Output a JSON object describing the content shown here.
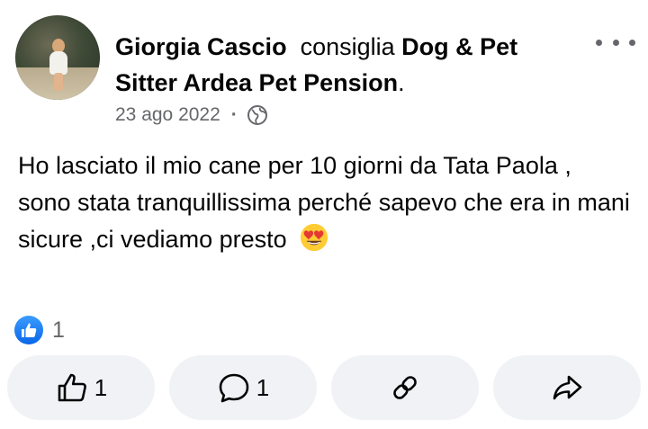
{
  "post": {
    "author": "Giorgia Cascio",
    "verb": "consiglia",
    "page_name": "Dog & Pet Sitter Ardea Pet Pension",
    "period": ".",
    "date": "23 ago 2022",
    "separator": "·",
    "audience_icon": "globe-icon",
    "text": "Ho lasciato il mio cane per 10 giorni da Tata Paola , sono stata tranquillissima perché sapevo che era in mani sicure ,ci vediamo presto",
    "emoji": "heart-eyes-emoji"
  },
  "reactions": {
    "icon": "like-icon",
    "count": "1"
  },
  "actions": {
    "like": {
      "icon": "thumbs-up-icon",
      "count": "1"
    },
    "comment": {
      "icon": "comment-bubble-icon",
      "count": "1"
    },
    "link": {
      "icon": "link-icon"
    },
    "share": {
      "icon": "share-arrow-icon"
    }
  },
  "colors": {
    "text": "#050505",
    "secondary": "#65676b",
    "button_bg": "#f0f2f5",
    "like_blue": "#0a66e8"
  }
}
